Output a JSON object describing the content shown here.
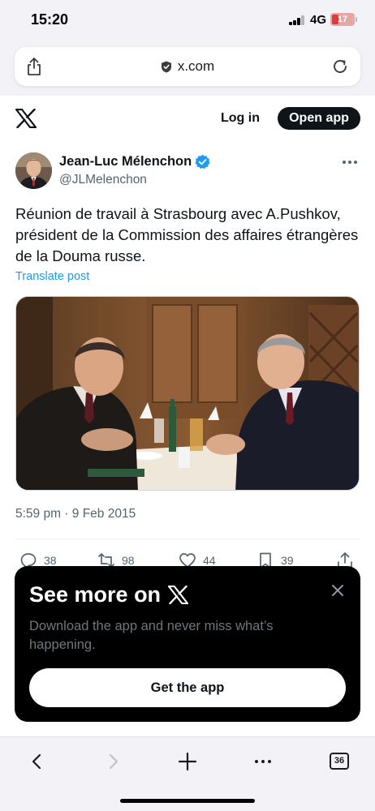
{
  "status_bar": {
    "time": "15:20",
    "network": "4G",
    "battery": "17"
  },
  "browser": {
    "url": "x.com",
    "tabs_count": "36",
    "icons": [
      "share-icon",
      "shield-icon",
      "reload-icon",
      "back-icon",
      "forward-icon",
      "new-tab-icon",
      "more-icon",
      "tabs-icon"
    ]
  },
  "header": {
    "login_label": "Log in",
    "open_app_label": "Open app"
  },
  "tweet": {
    "display_name": "Jean-Luc Mélenchon",
    "handle": "@JLMelenchon",
    "text": "Réunion de travail à Strasbourg avec A.Pushkov, président de la Commission des affaires étrangères de la Douma russe.",
    "translate_label": "Translate post",
    "timestamp": "5:59 pm · 9 Feb 2015",
    "actions": {
      "replies": "38",
      "reposts": "98",
      "likes": "44",
      "bookmarks": "39"
    }
  },
  "overlay": {
    "title": "See more on",
    "subtitle": "Download the app and never miss what’s happening.",
    "button_label": "Get the app"
  },
  "colors": {
    "accent": "#1d9bf0",
    "text": "#0f1419",
    "muted": "#536471"
  }
}
